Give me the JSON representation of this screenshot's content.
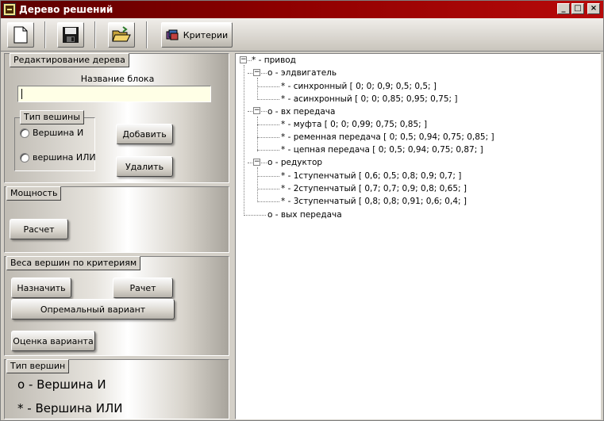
{
  "window": {
    "title": "Дерево решений"
  },
  "title_controls": {
    "minimize": "_",
    "maximize": "□",
    "close": "×"
  },
  "toolbar": {
    "criteria_label": "Критерии"
  },
  "edit_group": {
    "tab": "Редактирование дерева",
    "block_name_label": "Название блока",
    "block_name_value": "",
    "vertex_type_tab": "Тип вешины",
    "radio_and": "Вершина И",
    "radio_or": "вершина ИЛИ",
    "add_button": "Добавить",
    "delete_button": "Удалить"
  },
  "power_group": {
    "tab": "Мощность",
    "calc_button": "Расчет"
  },
  "weights_group": {
    "tab": "Веса вершин по критериям",
    "assign_button": "Назначить",
    "calc_button": "Рачет",
    "optimal_button": "Опремальный вариант",
    "evaluate_button": "Оценка варианта"
  },
  "vertex_types_group": {
    "tab": "Тип вершин",
    "line_and": "о - Вершина И",
    "line_or": "* - Вершина ИЛИ"
  },
  "tree": {
    "root": "* - привод",
    "nodes": [
      {
        "label": "о - элдвигатель",
        "expander": "−"
      },
      {
        "label": "* - синхронный [ 0; 0; 0,9; 0,5; 0,5; ]"
      },
      {
        "label": "* - асинхронный [ 0; 0; 0,85; 0,95; 0,75; ]"
      },
      {
        "label": "о - вх передача",
        "expander": "−"
      },
      {
        "label": "* - муфта [ 0; 0; 0,99; 0,75; 0,85; ]"
      },
      {
        "label": "* - ременная передача [ 0; 0,5; 0,94; 0,75; 0,85; ]"
      },
      {
        "label": "* - цепная передача [ 0; 0,5; 0,94; 0,75; 0,87; ]"
      },
      {
        "label": "о - редуктор",
        "expander": "−"
      },
      {
        "label": "* - 1ступенчатый [ 0,6; 0,5; 0,8; 0,9; 0,7; ]"
      },
      {
        "label": "* - 2ступенчатый [ 0,7; 0,7; 0,9; 0,8; 0,65; ]"
      },
      {
        "label": "* - 3ступенчатый [ 0,8; 0,8; 0,91; 0,6; 0,4; ]"
      },
      {
        "label": "о - вых передача"
      }
    ],
    "root_expander": "−"
  }
}
